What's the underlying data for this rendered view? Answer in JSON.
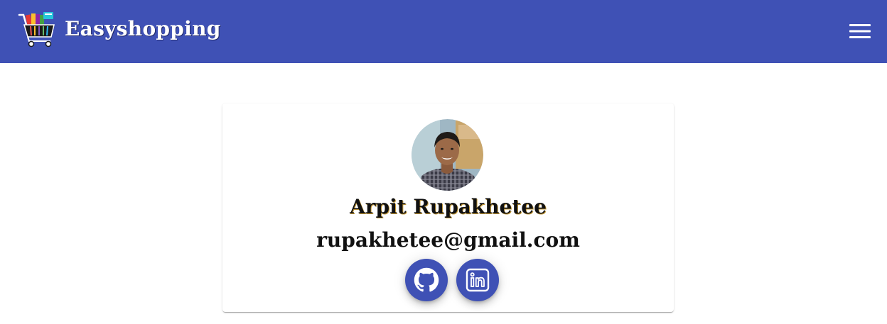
{
  "app": {
    "title": "Easyshopping",
    "logo_icon": "shopping-cart-icon",
    "menu_icon": "hamburger-menu-icon"
  },
  "profile": {
    "name": "Arpit Rupakhetee",
    "email": "rupakhetee@gmail.com",
    "avatar": "profile-photo"
  },
  "social": [
    {
      "icon": "github-icon"
    },
    {
      "icon": "linkedin-icon"
    }
  ],
  "colors": {
    "primary": "#3f51b5",
    "background": "#ffffff",
    "text": "#111111"
  }
}
